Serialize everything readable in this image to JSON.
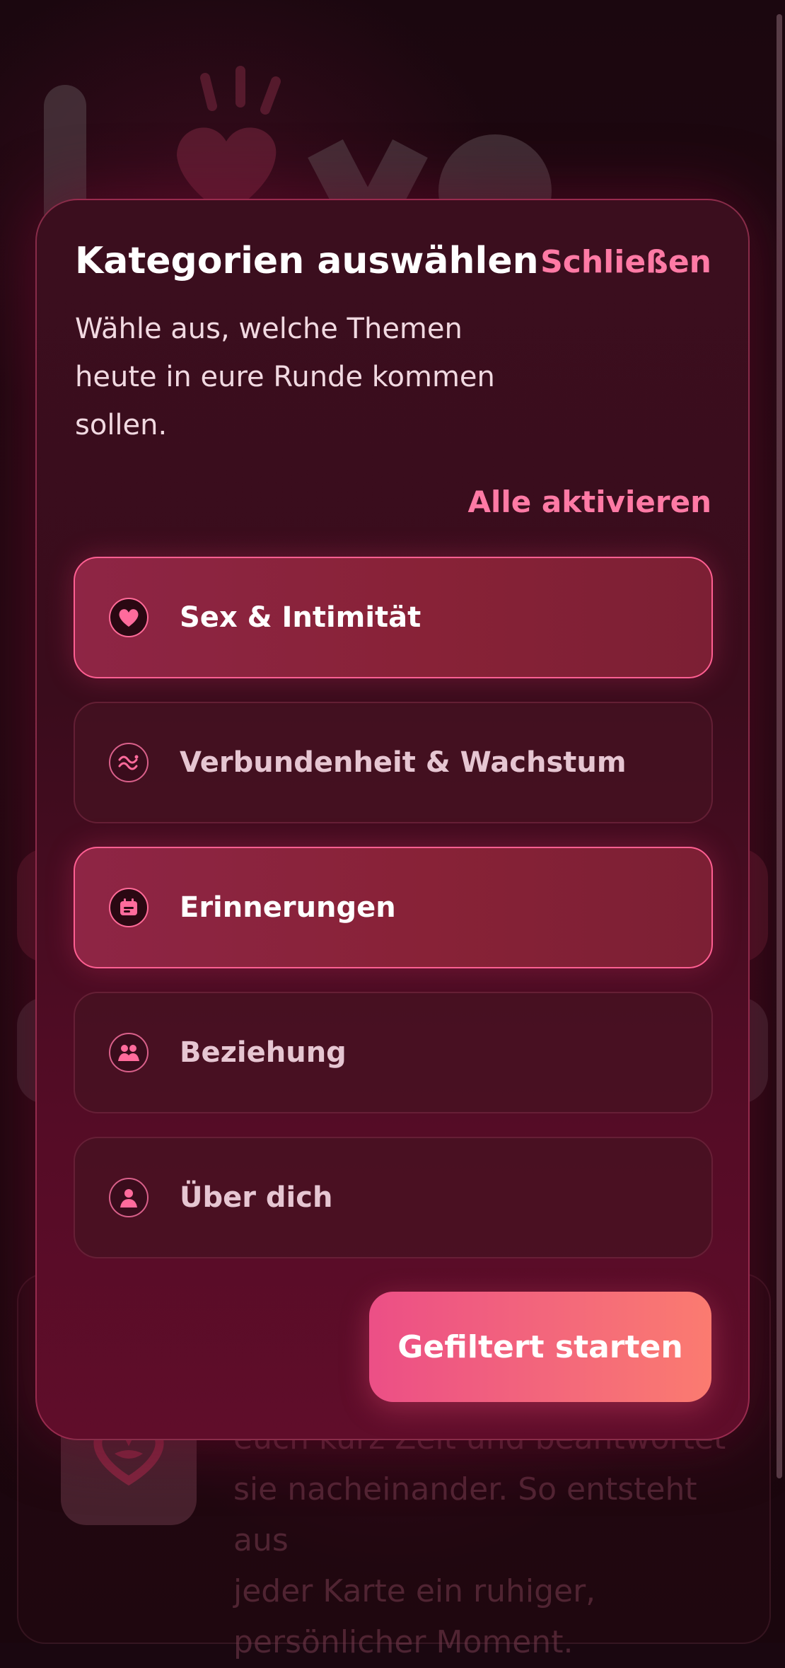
{
  "background": {
    "logo_text": "love",
    "text_lines": [
      "euch kurz Zeit und beantwortet",
      "sie nacheinander. So entsteht aus",
      "jeder Karte ein ruhiger,",
      "persönlicher Moment."
    ]
  },
  "modal": {
    "title": "Kategorien auswählen",
    "close_label": "Schließen",
    "subtitle": "Wähle aus, welche Themen heute in eure Runde kommen sollen.",
    "select_all_label": "Alle aktivieren",
    "categories": [
      {
        "label": "Sex & Intimität",
        "icon": "heart-icon",
        "active": true
      },
      {
        "label": "Verbundenheit & Wachstum",
        "icon": "waves-icon",
        "active": false
      },
      {
        "label": "Erinnerungen",
        "icon": "calendar-icon",
        "active": true
      },
      {
        "label": "Beziehung",
        "icon": "couple-icon",
        "active": false
      },
      {
        "label": "Über dich",
        "icon": "person-icon",
        "active": false
      }
    ],
    "start_label": "Gefiltert starten"
  },
  "colors": {
    "accent": "#ff7aa5",
    "active_card": "#8e2545",
    "button_start": "#ec4f86",
    "button_end": "#fb7b70"
  }
}
